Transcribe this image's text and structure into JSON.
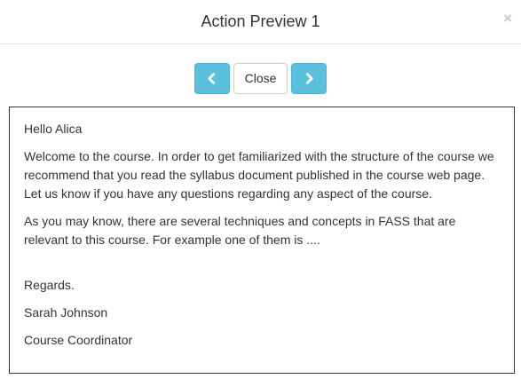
{
  "modal": {
    "title": "Action Preview 1",
    "close_glyph": "×"
  },
  "nav": {
    "prev_icon": "chevron-left-icon",
    "next_icon": "chevron-right-icon",
    "close_label": "Close",
    "accent_color": "#5bc0de"
  },
  "message": {
    "greeting": "Hello Alica",
    "paragraph1": "Welcome to the course. In order to get familiarized with the structure of the course we recommend that you read the syllabus document published in the course web page. Let us know if you have any questions regarding any aspect of the course.",
    "paragraph2": "As you may know, there are several techniques and concepts in FASS that are relevant to this course. For example one of them is ....",
    "closing": "Regards.",
    "sender_name": "Sarah Johnson",
    "sender_title": "Course Coordinator"
  }
}
